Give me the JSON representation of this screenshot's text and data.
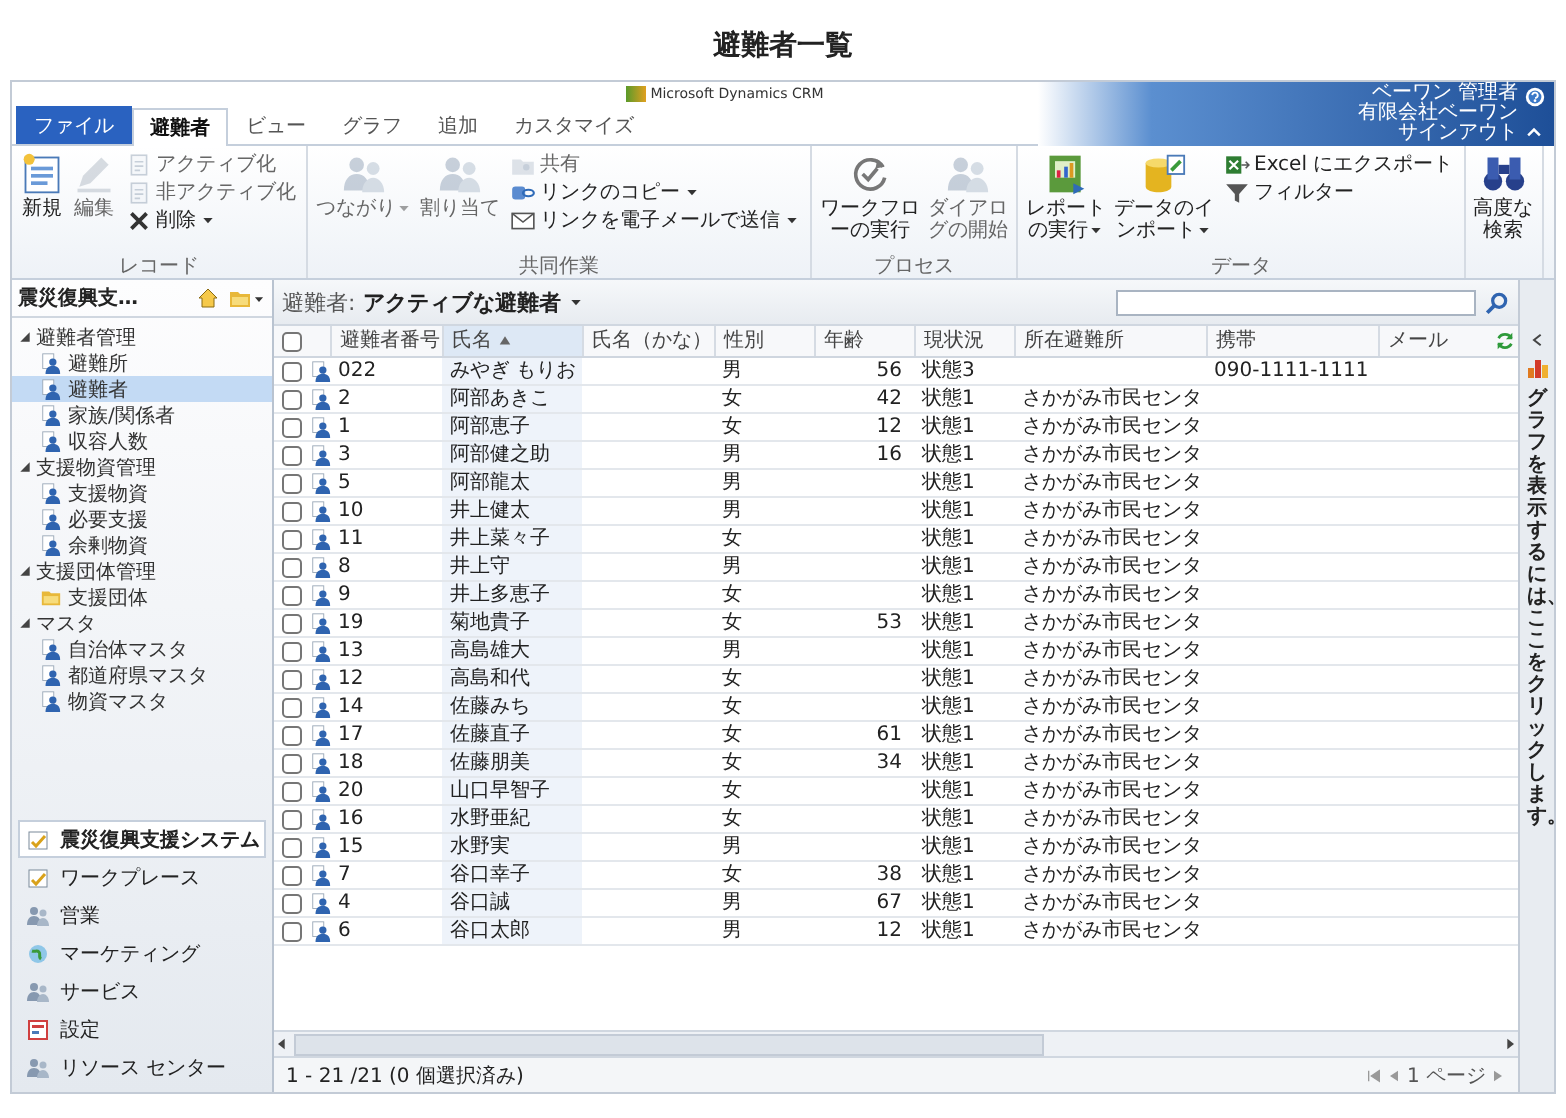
{
  "page_title": "避難者一覧",
  "product": "Microsoft Dynamics CRM",
  "user": {
    "name": "ベーワン 管理者",
    "organization": "有限会社ベーワン",
    "sign_out": "サインアウト"
  },
  "tabs": [
    {
      "label": "ファイル",
      "kind": "file",
      "selected": false
    },
    {
      "label": "避難者",
      "kind": "tab",
      "selected": true
    },
    {
      "label": "ビュー",
      "kind": "tab",
      "selected": false
    },
    {
      "label": "グラフ",
      "kind": "tab",
      "selected": false
    },
    {
      "label": "追加",
      "kind": "tab",
      "selected": false
    },
    {
      "label": "カスタマイズ",
      "kind": "tab",
      "selected": false
    }
  ],
  "ribbon": {
    "groups": [
      {
        "label": "レコード",
        "items": [
          {
            "kind": "large",
            "label": "新規",
            "disabled": false,
            "dropdown": false
          },
          {
            "kind": "large",
            "label": "編集",
            "disabled": true,
            "dropdown": false
          },
          {
            "kind": "small",
            "label": "アクティブ化",
            "disabled": true,
            "dropdown": false
          },
          {
            "kind": "small",
            "label": "非アクティブ化",
            "disabled": true,
            "dropdown": false
          },
          {
            "kind": "small",
            "label": "削除",
            "disabled": false,
            "dropdown": true
          }
        ]
      },
      {
        "label": "共同作業",
        "items": [
          {
            "kind": "large",
            "label": "つながり",
            "disabled": true,
            "dropdown": true
          },
          {
            "kind": "large",
            "label": "割り当て",
            "disabled": true,
            "dropdown": false
          },
          {
            "kind": "small",
            "label": "共有",
            "disabled": true,
            "dropdown": false
          },
          {
            "kind": "small",
            "label": "リンクのコピー",
            "disabled": false,
            "dropdown": true
          },
          {
            "kind": "small",
            "label": "リンクを電子メールで送信",
            "disabled": false,
            "dropdown": true
          }
        ]
      },
      {
        "label": "プロセス",
        "items": [
          {
            "kind": "large",
            "label": "ワークフローの実行",
            "disabled": false,
            "dropdown": false
          },
          {
            "kind": "large",
            "label": "ダイアログの開始",
            "disabled": true,
            "dropdown": false
          }
        ]
      },
      {
        "label": "データ",
        "items": [
          {
            "kind": "large",
            "label": "レポートの実行",
            "disabled": false,
            "dropdown": true
          },
          {
            "kind": "large",
            "label": "データのインポート",
            "disabled": false,
            "dropdown": true
          },
          {
            "kind": "small",
            "label": "Excel にエクスポート",
            "disabled": false,
            "dropdown": false
          },
          {
            "kind": "small",
            "label": "フィルター",
            "disabled": false,
            "dropdown": false
          }
        ]
      },
      {
        "items": [
          {
            "kind": "large",
            "label": "高度な検索",
            "disabled": false,
            "dropdown": false
          }
        ]
      }
    ]
  },
  "sidebar": {
    "title": "震災復興支…",
    "sections": [
      {
        "label": "避難者管理",
        "expanded": true,
        "children": [
          {
            "label": "避難所",
            "selected": false
          },
          {
            "label": "避難者",
            "selected": true
          },
          {
            "label": "家族/関係者",
            "selected": false
          },
          {
            "label": "収容人数",
            "selected": false
          }
        ]
      },
      {
        "label": "支援物資管理",
        "expanded": true,
        "children": [
          {
            "label": "支援物資",
            "selected": false
          },
          {
            "label": "必要支援",
            "selected": false
          },
          {
            "label": "余剰物資",
            "selected": false
          }
        ]
      },
      {
        "label": "支援団体管理",
        "expanded": true,
        "children": [
          {
            "label": "支援団体",
            "selected": false
          }
        ]
      },
      {
        "label": "マスタ",
        "expanded": true,
        "children": [
          {
            "label": "自治体マスタ",
            "selected": false
          },
          {
            "label": "都道府県マスタ",
            "selected": false
          },
          {
            "label": "物資マスタ",
            "selected": false
          }
        ]
      }
    ],
    "nav": [
      {
        "label": "震災復興支援システム",
        "selected": true
      },
      {
        "label": "ワークプレース",
        "selected": false
      },
      {
        "label": "営業",
        "selected": false
      },
      {
        "label": "マーケティング",
        "selected": false
      },
      {
        "label": "サービス",
        "selected": false
      },
      {
        "label": "設定",
        "selected": false
      },
      {
        "label": "リソース センター",
        "selected": false
      }
    ]
  },
  "grid": {
    "view_label": "避難者:",
    "view_name": "アクティブな避難者",
    "select_all": {
      "checked": false
    },
    "columns": [
      {
        "label": "避難者番号",
        "sorted": false
      },
      {
        "label": "氏名",
        "sorted": true
      },
      {
        "label": "氏名（かな）",
        "sorted": false
      },
      {
        "label": "性別",
        "sorted": false
      },
      {
        "label": "年齢",
        "sorted": false
      },
      {
        "label": "現状況",
        "sorted": false
      },
      {
        "label": "所在避難所",
        "sorted": false
      },
      {
        "label": "携帯",
        "sorted": false
      },
      {
        "label": "メール",
        "sorted": false
      }
    ],
    "rows": [
      {
        "checked": false,
        "number": "022",
        "name": "みやぎ もりお",
        "gender": "男",
        "age": "56",
        "status": "状態3",
        "mobile": "090-1111-1111"
      },
      {
        "checked": false,
        "number": "2",
        "name": "阿部あきこ",
        "gender": "女",
        "age": "42",
        "status": "状態1",
        "shelter": "さかがみ市民センタ"
      },
      {
        "checked": false,
        "number": "1",
        "name": "阿部恵子",
        "gender": "女",
        "age": "12",
        "status": "状態1",
        "shelter": "さかがみ市民センタ"
      },
      {
        "checked": false,
        "number": "3",
        "name": "阿部健之助",
        "gender": "男",
        "age": "16",
        "status": "状態1",
        "shelter": "さかがみ市民センタ"
      },
      {
        "checked": false,
        "number": "5",
        "name": "阿部龍太",
        "gender": "男",
        "status": "状態1",
        "shelter": "さかがみ市民センタ"
      },
      {
        "checked": false,
        "number": "10",
        "name": "井上健太",
        "gender": "男",
        "status": "状態1",
        "shelter": "さかがみ市民センタ"
      },
      {
        "checked": false,
        "number": "11",
        "name": "井上菜々子",
        "gender": "女",
        "status": "状態1",
        "shelter": "さかがみ市民センタ"
      },
      {
        "checked": false,
        "number": "8",
        "name": "井上守",
        "gender": "男",
        "status": "状態1",
        "shelter": "さかがみ市民センタ"
      },
      {
        "checked": false,
        "number": "9",
        "name": "井上多恵子",
        "gender": "女",
        "status": "状態1",
        "shelter": "さかがみ市民センタ"
      },
      {
        "checked": false,
        "number": "19",
        "name": "菊地貴子",
        "gender": "女",
        "age": "53",
        "status": "状態1",
        "shelter": "さかがみ市民センタ"
      },
      {
        "checked": false,
        "number": "13",
        "name": "高島雄大",
        "gender": "男",
        "status": "状態1",
        "shelter": "さかがみ市民センタ"
      },
      {
        "checked": false,
        "number": "12",
        "name": "高島和代",
        "gender": "女",
        "status": "状態1",
        "shelter": "さかがみ市民センタ"
      },
      {
        "checked": false,
        "number": "14",
        "name": "佐藤みち",
        "gender": "女",
        "status": "状態1",
        "shelter": "さかがみ市民センタ"
      },
      {
        "checked": false,
        "number": "17",
        "name": "佐藤直子",
        "gender": "女",
        "age": "61",
        "status": "状態1",
        "shelter": "さかがみ市民センタ"
      },
      {
        "checked": false,
        "number": "18",
        "name": "佐藤朋美",
        "gender": "女",
        "age": "34",
        "status": "状態1",
        "shelter": "さかがみ市民センタ"
      },
      {
        "checked": false,
        "number": "20",
        "name": "山口早智子",
        "gender": "女",
        "status": "状態1",
        "shelter": "さかがみ市民センタ"
      },
      {
        "checked": false,
        "number": "16",
        "name": "水野亜紀",
        "gender": "女",
        "status": "状態1",
        "shelter": "さかがみ市民センタ"
      },
      {
        "checked": false,
        "number": "15",
        "name": "水野実",
        "gender": "男",
        "status": "状態1",
        "shelter": "さかがみ市民センタ"
      },
      {
        "checked": false,
        "number": "7",
        "name": "谷口幸子",
        "gender": "女",
        "age": "38",
        "status": "状態1",
        "shelter": "さかがみ市民センタ"
      },
      {
        "checked": false,
        "number": "4",
        "name": "谷口誠",
        "gender": "男",
        "age": "67",
        "status": "状態1",
        "shelter": "さかがみ市民センタ"
      },
      {
        "checked": false,
        "number": "6",
        "name": "谷口太郎",
        "gender": "男",
        "age": "12",
        "status": "状態1",
        "shelter": "さかがみ市民センタ"
      }
    ],
    "status": "1 - 21 /21 (0 個選択済み)",
    "page": "1 ページ"
  },
  "chart_pane": {
    "hint": "グラフを表示するには、ここをクリックします。"
  }
}
